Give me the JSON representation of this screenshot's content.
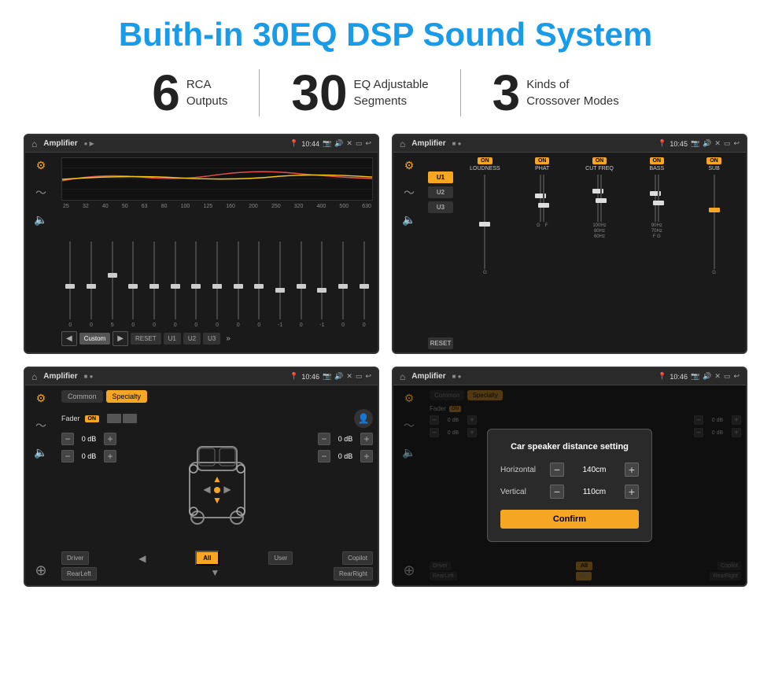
{
  "header": {
    "title": "Buith-in 30EQ DSP Sound System"
  },
  "stats": [
    {
      "number": "6",
      "text_line1": "RCA",
      "text_line2": "Outputs"
    },
    {
      "number": "30",
      "text_line1": "EQ Adjustable",
      "text_line2": "Segments"
    },
    {
      "number": "3",
      "text_line1": "Kinds of",
      "text_line2": "Crossover Modes"
    }
  ],
  "screens": [
    {
      "id": "screen1",
      "title": "Amplifier",
      "time": "10:44",
      "type": "eq"
    },
    {
      "id": "screen2",
      "title": "Amplifier",
      "time": "10:45",
      "type": "amp"
    },
    {
      "id": "screen3",
      "title": "Amplifier",
      "time": "10:46",
      "type": "fader"
    },
    {
      "id": "screen4",
      "title": "Amplifier",
      "time": "10:46",
      "type": "dialog"
    }
  ],
  "eq": {
    "freq_labels": [
      "25",
      "32",
      "40",
      "50",
      "63",
      "80",
      "100",
      "125",
      "160",
      "200",
      "250",
      "320",
      "400",
      "500",
      "630"
    ],
    "preset": "Custom",
    "buttons": [
      "RESET",
      "U1",
      "U2",
      "U3"
    ]
  },
  "amp": {
    "presets": [
      "U1",
      "U2",
      "U3"
    ],
    "controls": [
      {
        "label": "LOUDNESS",
        "on": true
      },
      {
        "label": "PHAT",
        "on": true
      },
      {
        "label": "CUT FREQ",
        "on": true
      },
      {
        "label": "BASS",
        "on": true
      },
      {
        "label": "SUB",
        "on": true
      }
    ]
  },
  "fader": {
    "tabs": [
      "Common",
      "Specialty"
    ],
    "fader_label": "Fader",
    "on_label": "ON",
    "positions": [
      {
        "label": "0 dB"
      },
      {
        "label": "0 dB"
      },
      {
        "label": "0 dB"
      },
      {
        "label": "0 dB"
      }
    ],
    "position_labels": [
      "Driver",
      "RearLeft",
      "All",
      "Copilot",
      "RearRight",
      "User"
    ]
  },
  "dialog": {
    "title": "Car speaker distance setting",
    "horizontal_label": "Horizontal",
    "horizontal_value": "140cm",
    "vertical_label": "Vertical",
    "vertical_value": "110cm",
    "confirm_label": "Confirm"
  }
}
